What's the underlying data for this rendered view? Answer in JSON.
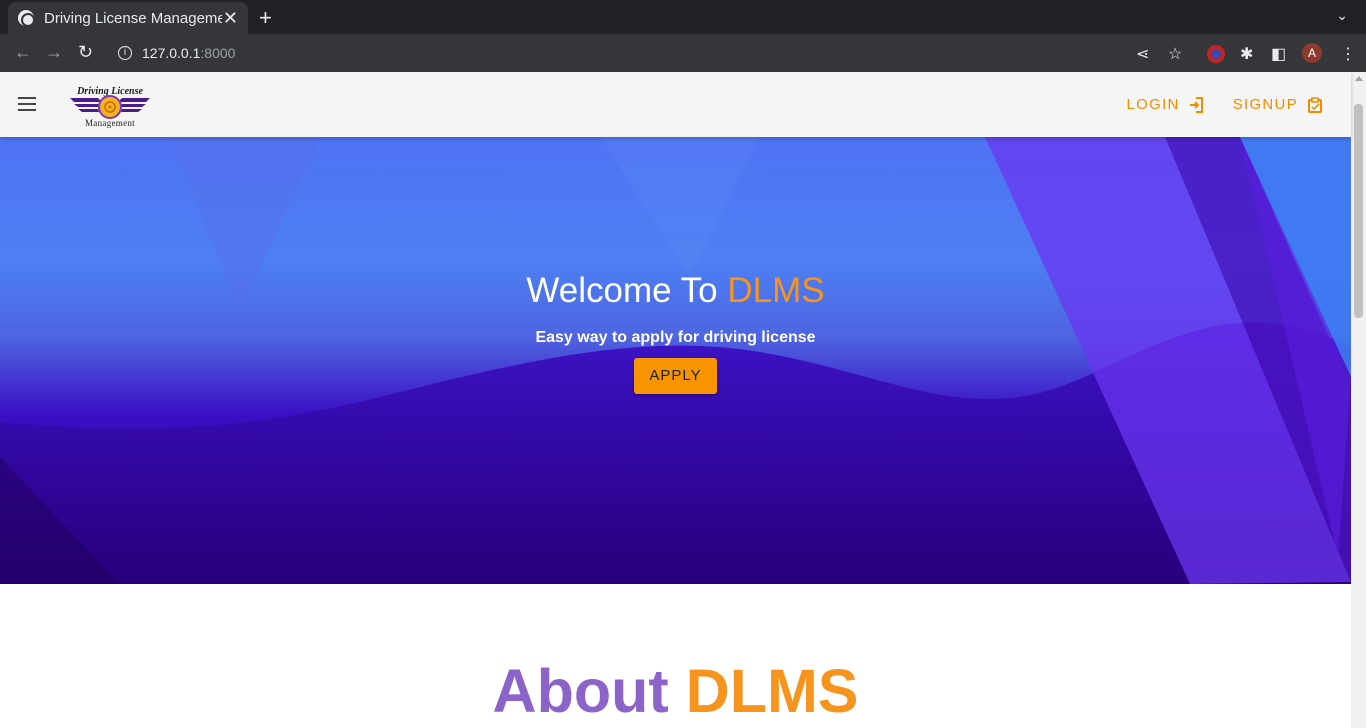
{
  "browser": {
    "tab_title": "Driving License Management",
    "tab_close": "✕",
    "new_tab": "+",
    "tab_menu": "⌄",
    "url_host": "127.0.0.1",
    "url_port": ":8000",
    "avatar_letter": "A"
  },
  "navbar": {
    "logo_top": "Driving License",
    "logo_bottom": "Management",
    "login_label": "LOGIN",
    "signup_label": "SIGNUP"
  },
  "hero": {
    "title_prefix": "Welcome To ",
    "title_accent": "DLMS",
    "subtitle": "Easy way to apply for driving license",
    "apply_label": "APPLY"
  },
  "about": {
    "title_prefix": "About ",
    "title_accent": "DLMS"
  },
  "colors": {
    "accent": "#f7941d",
    "purple": "#8b63c9"
  }
}
